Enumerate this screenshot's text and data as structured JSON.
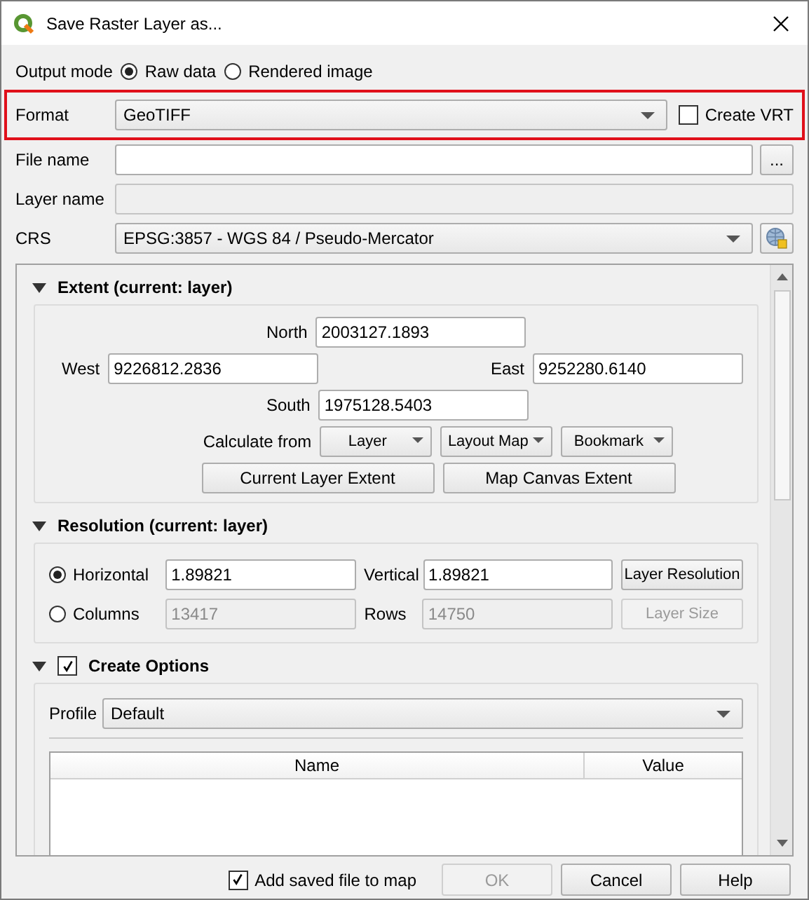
{
  "window": {
    "title": "Save Raster Layer as..."
  },
  "output_mode": {
    "label": "Output mode",
    "options": [
      {
        "label": "Raw data",
        "selected": true
      },
      {
        "label": "Rendered image",
        "selected": false
      }
    ]
  },
  "format": {
    "label": "Format",
    "value": "GeoTIFF",
    "highlighted": true,
    "create_vrt": {
      "label": "Create VRT",
      "checked": false
    }
  },
  "file_name": {
    "label": "File name",
    "browse_button": "..."
  },
  "layer_name": {
    "label": "Layer name",
    "disabled": true
  },
  "crs": {
    "label": "CRS",
    "value": "EPSG:3857 - WGS 84 / Pseudo-Mercator"
  },
  "extent": {
    "title": "Extent (current: layer)",
    "expanded": true,
    "north": {
      "label": "North",
      "value": "2003127.1893"
    },
    "west": {
      "label": "West",
      "value": "9226812.2836"
    },
    "east": {
      "label": "East",
      "value": "9252280.6140"
    },
    "south": {
      "label": "South",
      "value": "1975128.5403"
    },
    "calculate_from": {
      "label": "Calculate from",
      "menus": [
        "Layer",
        "Layout Map",
        "Bookmark"
      ]
    },
    "buttons": [
      "Current Layer Extent",
      "Map Canvas Extent"
    ]
  },
  "resolution": {
    "title": "Resolution (current: layer)",
    "expanded": true,
    "modes": [
      {
        "label": "Horizontal",
        "selected": true,
        "value": "1.89821",
        "other_label": "Vertical",
        "other_value": "1.89821",
        "button": "Layer Resolution"
      },
      {
        "label": "Columns",
        "selected": false,
        "value": "13417",
        "other_label": "Rows",
        "other_value": "14750",
        "button": "Layer Size"
      }
    ]
  },
  "create_options": {
    "title": "Create Options",
    "expanded": true,
    "checked": true,
    "profile": {
      "label": "Profile",
      "value": "Default"
    },
    "table": {
      "columns": [
        "Name",
        "Value"
      ]
    }
  },
  "footer": {
    "add_to_map": {
      "label": "Add saved file to map",
      "checked": true
    },
    "buttons": [
      {
        "label": "OK",
        "disabled": true
      },
      {
        "label": "Cancel",
        "disabled": false
      },
      {
        "label": "Help",
        "disabled": false
      }
    ]
  }
}
